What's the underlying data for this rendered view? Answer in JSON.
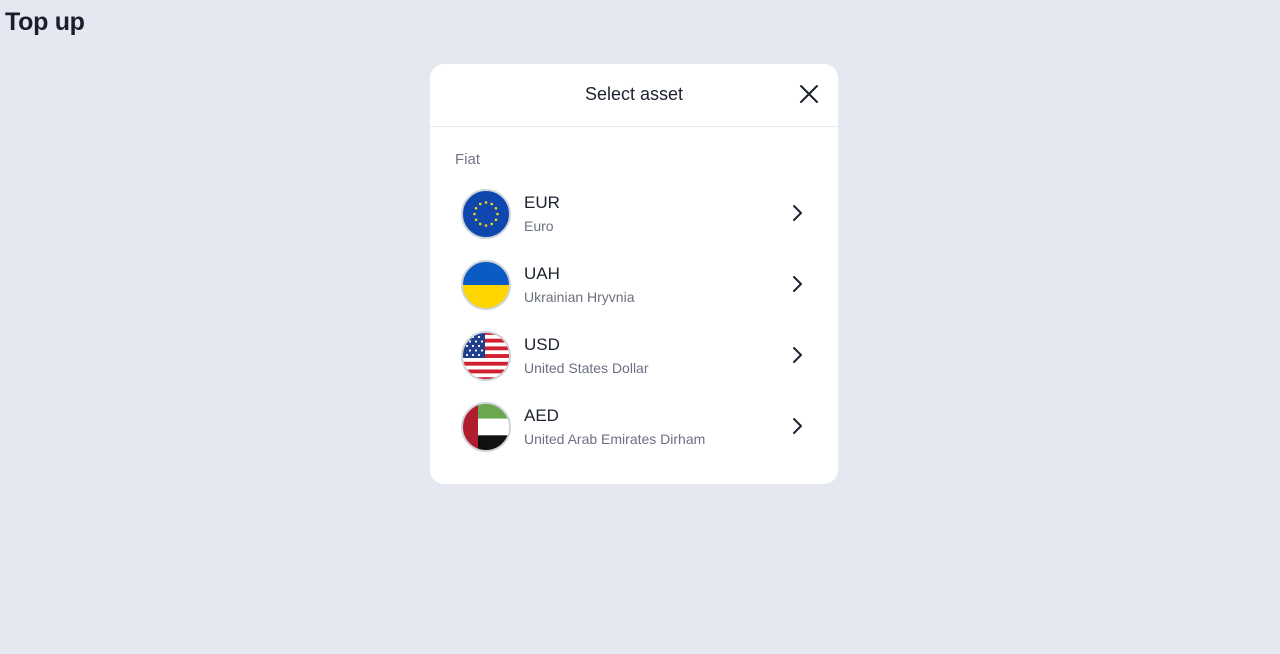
{
  "page": {
    "title": "Top up"
  },
  "modal": {
    "title": "Select asset",
    "close_icon": "close-icon",
    "section_label": "Fiat",
    "assets": [
      {
        "code": "EUR",
        "name": "Euro",
        "icon": "eu-flag-icon"
      },
      {
        "code": "UAH",
        "name": "Ukrainian Hryvnia",
        "icon": "ukraine-flag-icon"
      },
      {
        "code": "USD",
        "name": "United States Dollar",
        "icon": "us-flag-icon"
      },
      {
        "code": "AED",
        "name": "United Arab Emirates Dirham",
        "icon": "uae-flag-icon"
      }
    ],
    "row_action_icon": "chevron-right-icon"
  },
  "colors": {
    "background": "#e5e8f0",
    "card": "#ffffff",
    "text_primary": "#1c2230",
    "text_secondary": "#6b7180"
  }
}
